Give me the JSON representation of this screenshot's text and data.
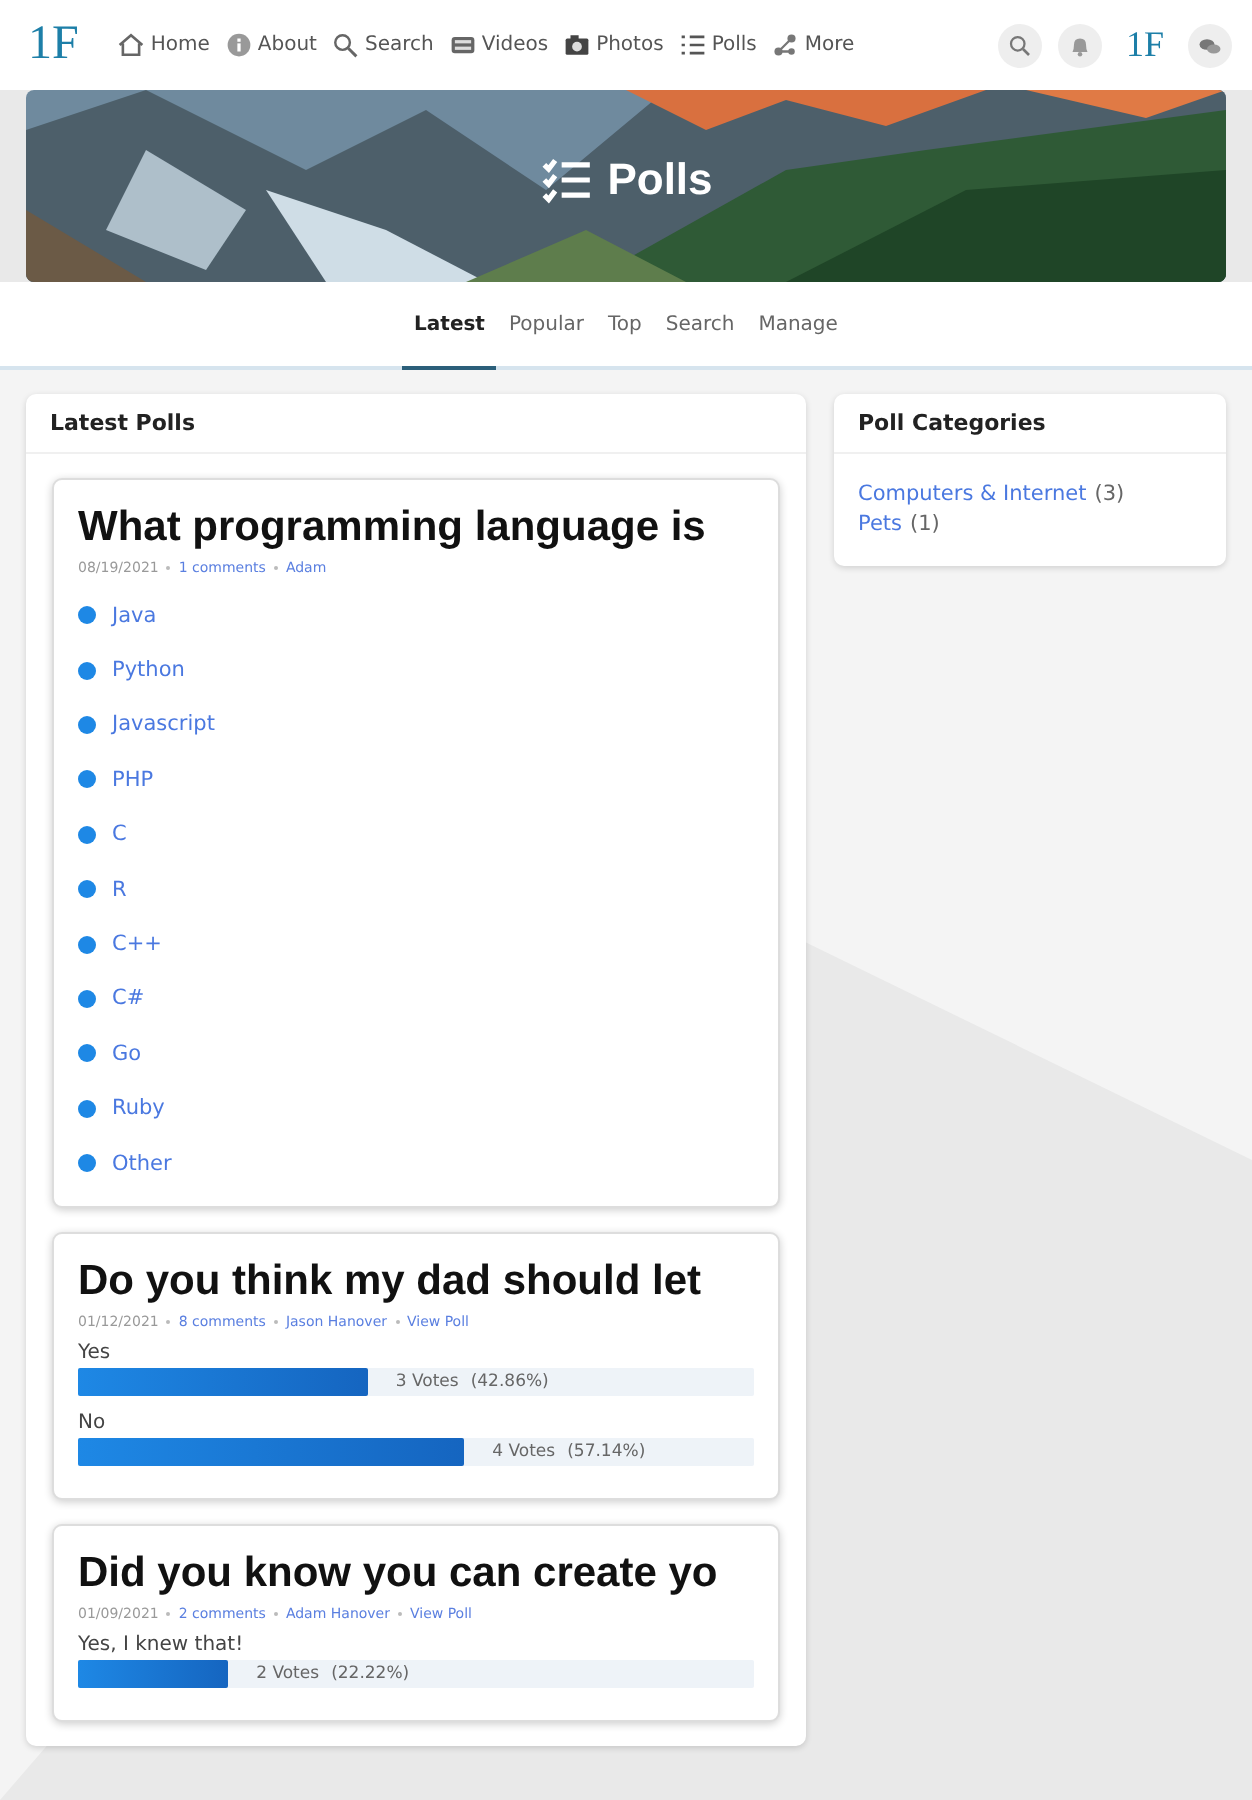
{
  "nav": {
    "logo": "1F",
    "items": [
      {
        "label": "Home"
      },
      {
        "label": "About"
      },
      {
        "label": "Search"
      },
      {
        "label": "Videos"
      },
      {
        "label": "Photos"
      },
      {
        "label": "Polls"
      },
      {
        "label": "More"
      }
    ],
    "right_logo": "1F"
  },
  "banner": {
    "title": "Polls"
  },
  "tabs": [
    {
      "label": "Latest",
      "selected": true
    },
    {
      "label": "Popular",
      "selected": false
    },
    {
      "label": "Top",
      "selected": false
    },
    {
      "label": "Search",
      "selected": false
    },
    {
      "label": "Manage",
      "selected": false
    }
  ],
  "latest": {
    "title": "Latest Polls",
    "polls": [
      {
        "kind": "options",
        "question": "What programming language is",
        "date": "08/19/2021",
        "links": [
          "1 comments",
          "Adam"
        ],
        "options": [
          "Java",
          "Python",
          "Javascript",
          "PHP",
          "C",
          "R",
          "C++",
          "C#",
          "Go",
          "Ruby",
          "Other"
        ]
      },
      {
        "kind": "results",
        "question": "Do you think my dad should let",
        "date": "01/12/2021",
        "links": [
          "8 comments",
          "Jason Hanover",
          "View Poll"
        ],
        "results": [
          {
            "answer": "Yes",
            "level": 0.4286,
            "votes": "3 Votes",
            "percent": "(42.86%)"
          },
          {
            "answer": "No",
            "level": 0.5714,
            "votes": "4 Votes",
            "percent": "(57.14%)"
          }
        ]
      },
      {
        "kind": "results",
        "question": "Did you know you can create yo",
        "date": "01/09/2021",
        "links": [
          "2 comments",
          "Adam Hanover",
          "View Poll"
        ],
        "results": [
          {
            "answer": "Yes, I knew that!",
            "level": 0.2222,
            "votes": "2 Votes",
            "percent": "(22.22%)"
          }
        ]
      }
    ]
  },
  "categories": {
    "title": "Poll Categories",
    "items": [
      {
        "name": "Computers & Internet",
        "count": "(3)"
      },
      {
        "name": "Pets",
        "count": "(1)"
      }
    ]
  }
}
